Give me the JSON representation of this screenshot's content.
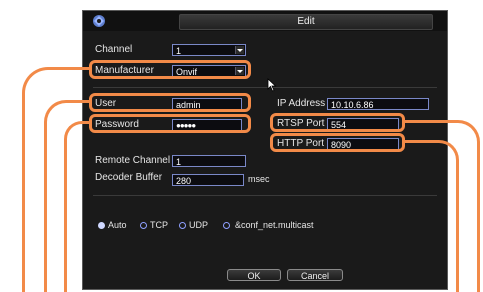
{
  "dialog": {
    "title": "Edit",
    "fields": {
      "channel_label": "Channel",
      "channel_value": "1",
      "manufacturer_label": "Manufacturer",
      "manufacturer_value": "Onvif",
      "user_label": "User",
      "user_value": "admin",
      "password_label": "Password",
      "password_value": "●●●●●",
      "ip_label": "IP Address",
      "ip_value": "10.10.6.86",
      "rtsp_label": "RTSP Port",
      "rtsp_value": "554",
      "http_label": "HTTP Port",
      "http_value": "8090",
      "remote_channel_label": "Remote Channel",
      "remote_channel_value": "1",
      "decoder_buffer_label": "Decoder Buffer",
      "decoder_buffer_value": "280",
      "decoder_buffer_unit": "msec"
    },
    "protocol": {
      "selected": "Auto",
      "options": [
        "Auto",
        "TCP",
        "UDP",
        "&conf_net.multicast"
      ]
    },
    "buttons": {
      "ok": "OK",
      "cancel": "Cancel"
    }
  },
  "icons": {
    "logo": "app-logo-icon",
    "cursor": "mouse-cursor-icon"
  },
  "colors": {
    "annotation": "#f28a48",
    "field_border": "#7a88c8",
    "dialog_bg": "#1a1a1a"
  }
}
